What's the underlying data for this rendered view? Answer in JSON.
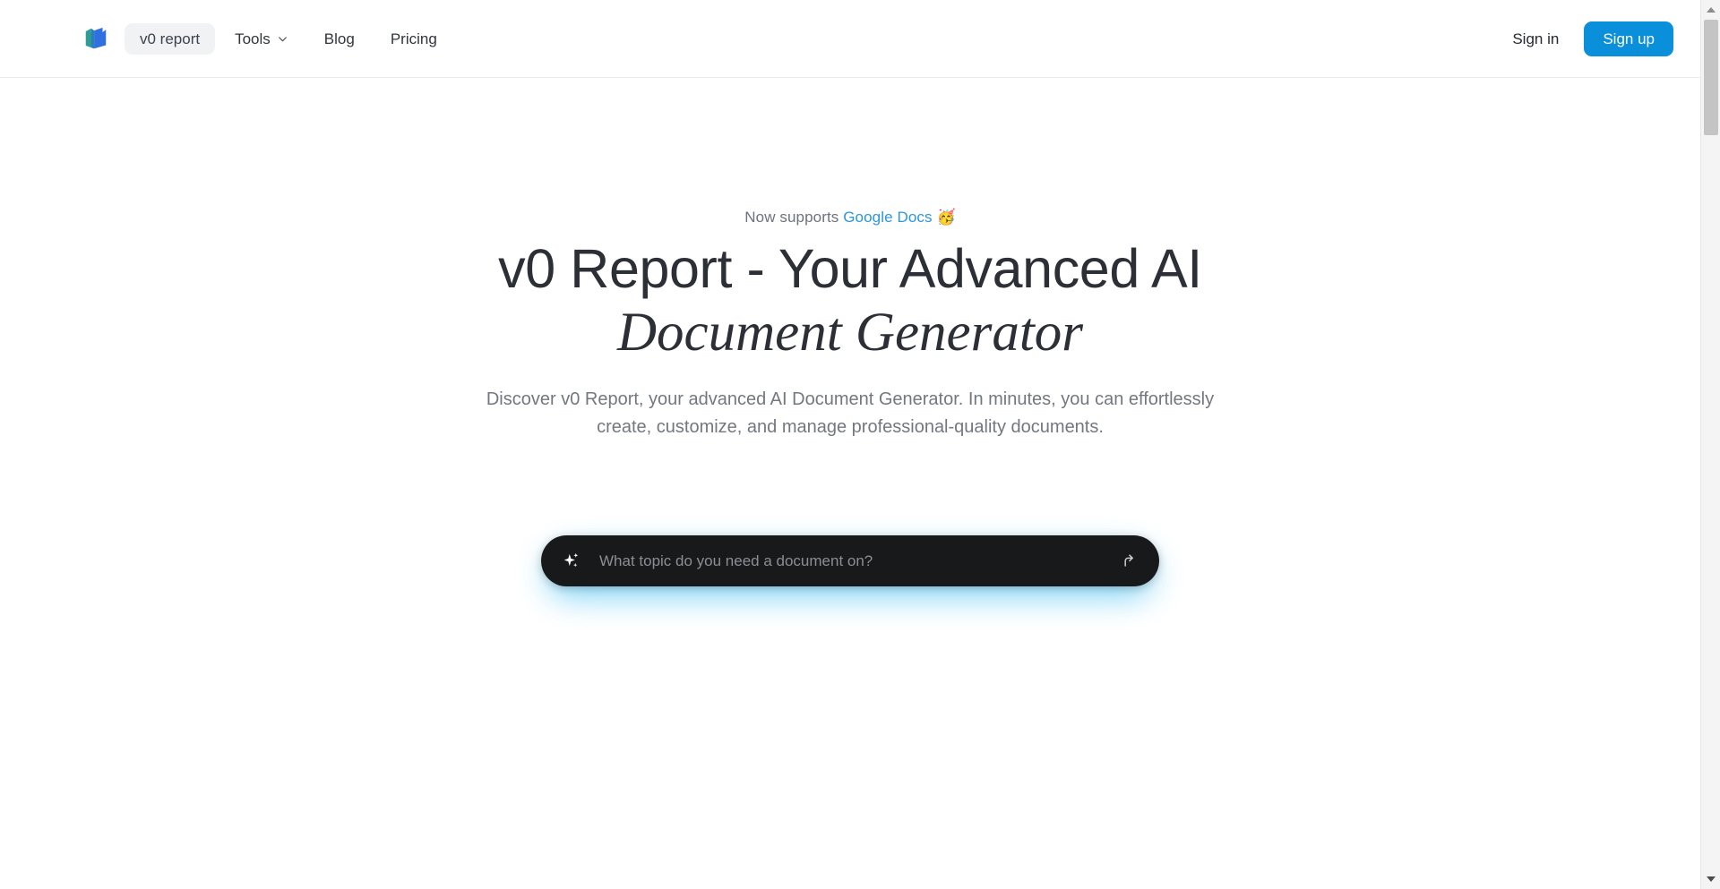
{
  "header": {
    "logo_icon": "v0-report-logo-icon",
    "nav_left": [
      {
        "label": "v0 report",
        "type": "pill"
      },
      {
        "label": "Tools",
        "type": "menu",
        "icon": "chevron-down-icon"
      },
      {
        "label": "Blog",
        "type": "link"
      },
      {
        "label": "Pricing",
        "type": "link"
      }
    ],
    "sign_in_label": "Sign in",
    "sign_up_label": "Sign up",
    "accent_color": "#0a8fdb"
  },
  "hero": {
    "announce_prefix": "Now supports",
    "announce_link": "Google Docs",
    "announce_emoji": "🥳",
    "announce_link_color": "#2b96e0",
    "title_line1": "v0 Report - Your Advanced AI",
    "title_line2": "Document Generator",
    "subtitle": "Discover v0 Report, your advanced AI Document Generator. In minutes, you can effortlessly create, customize, and manage professional-quality documents."
  },
  "prompt": {
    "placeholder": "What topic do you need a document on?",
    "value": "",
    "leading_icon": "sparkles-icon",
    "submit_icon": "enter-arrow-icon",
    "background_color": "#17191b",
    "glow_color": "#7fd4f7"
  },
  "scrollbar": {
    "up_icon": "scroll-up-arrow-icon",
    "down_icon": "scroll-down-arrow-icon"
  }
}
